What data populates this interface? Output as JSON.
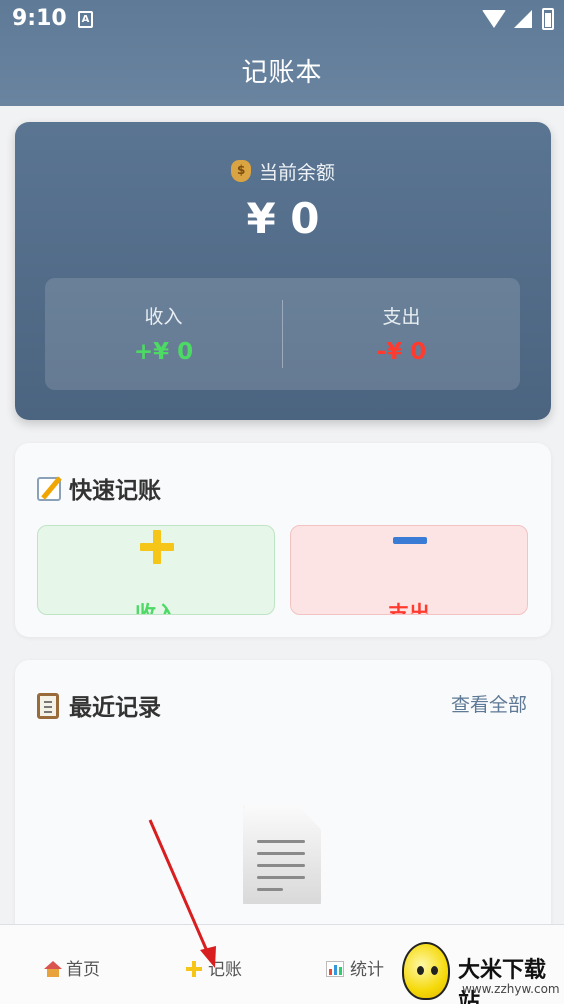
{
  "status_bar": {
    "time": "9:10",
    "notification_icon_letter": "A"
  },
  "app_bar": {
    "title": "记账本"
  },
  "balance": {
    "label": "当前余额",
    "amount": "¥ 0",
    "income_label": "收入",
    "income_value": "+¥ 0",
    "expense_label": "支出",
    "expense_value": "-¥ 0"
  },
  "quick_entry": {
    "title": "快速记账",
    "income_button": "收入",
    "expense_button": "支出"
  },
  "recent": {
    "title": "最近记录",
    "view_all": "查看全部"
  },
  "bottom_nav": {
    "home": "首页",
    "add": "记账",
    "stats": "统计"
  },
  "watermark": {
    "title": "大米下载站",
    "url": "www.zzhyw.com"
  },
  "colors": {
    "app_bar": "#5e7a96",
    "income": "#4cd964",
    "expense": "#ff3b30",
    "annotation_arrow": "#d81e1e"
  },
  "icons": {
    "balance": "money-bag-icon",
    "quick_entry": "memo-icon",
    "recent": "clipboard-icon",
    "empty_state": "document-icon",
    "nav_home": "house-icon",
    "nav_add": "plus-icon",
    "nav_stats": "bar-chart-icon"
  }
}
